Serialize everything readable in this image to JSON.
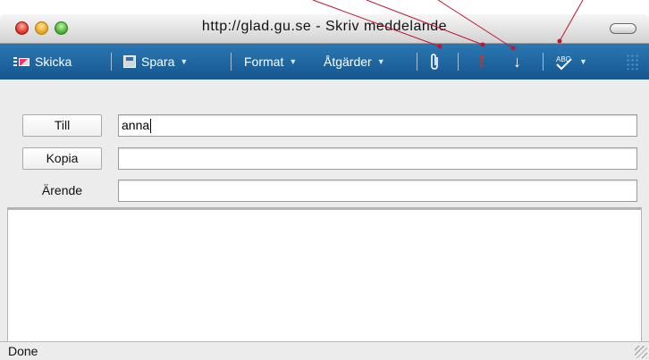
{
  "window": {
    "title": "http://glad.gu.se - Skriv meddelande"
  },
  "toolbar": {
    "send_label": "Skicka",
    "save_label": "Spara",
    "format_label": "Format",
    "actions_label": "Åtgärder",
    "attach_icon": "paperclip-icon",
    "high_priority_glyph": "!",
    "low_priority_glyph": "↓",
    "spellcheck_glyph": "ABC",
    "dropdown_glyph": "▼"
  },
  "fields": {
    "to": {
      "label": "Till",
      "value": "anna"
    },
    "cc": {
      "label": "Kopia",
      "value": ""
    },
    "subject": {
      "label": "Ärende",
      "value": ""
    }
  },
  "status": {
    "text": "Done"
  },
  "colors": {
    "toolbar_top": "#2b78b4",
    "toolbar_bottom": "#15568e",
    "priority_high": "#e02a1f",
    "annotation": "#c0162f"
  }
}
